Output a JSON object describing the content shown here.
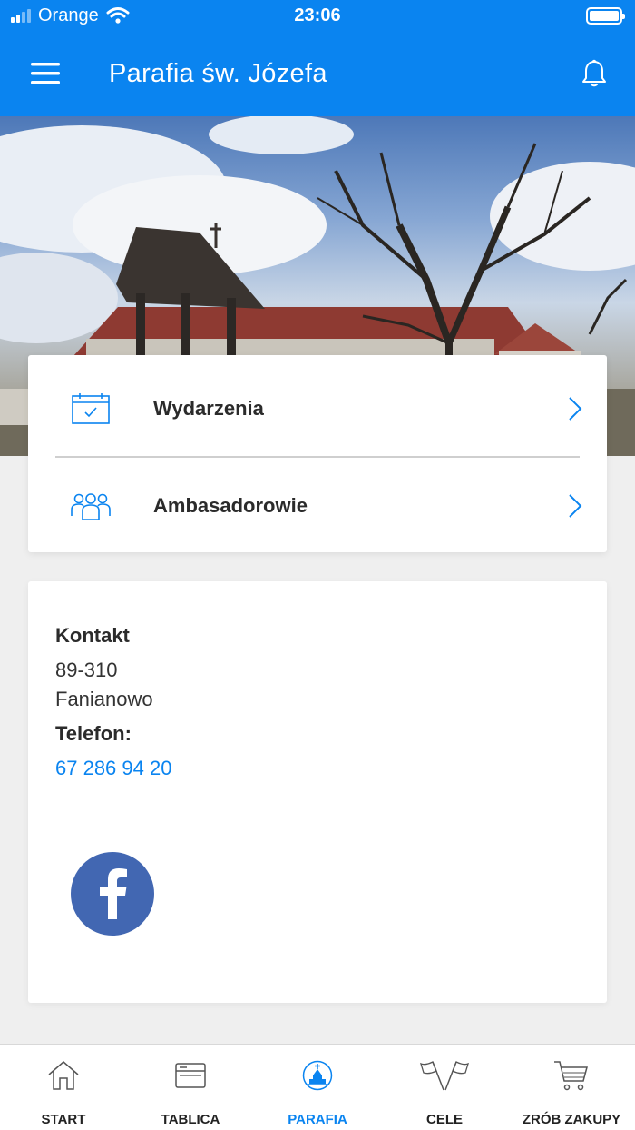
{
  "status_bar": {
    "carrier": "Orange",
    "time": "23:06"
  },
  "header": {
    "title": "Parafia św. Józefa"
  },
  "menu": {
    "items": [
      {
        "label": "Wydarzenia",
        "icon": "calendar-icon"
      },
      {
        "label": "Ambasadorowie",
        "icon": "group-icon"
      }
    ]
  },
  "contact": {
    "heading": "Kontakt",
    "postal_code": "89-310",
    "city": "Fanianowo",
    "phone_label": "Telefon:",
    "phone": "67 286 94 20",
    "social": "facebook-icon"
  },
  "bottom_nav": {
    "items": [
      {
        "label": "START",
        "icon": "home-icon"
      },
      {
        "label": "TABLICA",
        "icon": "board-icon"
      },
      {
        "label": "PARAFIA",
        "icon": "church-icon",
        "active": true
      },
      {
        "label": "CELE",
        "icon": "flags-icon"
      },
      {
        "label": "ZRÓB ZAKUPY",
        "icon": "cart-icon"
      }
    ]
  },
  "colors": {
    "accent": "#0a84f0",
    "facebook": "#4267b2"
  }
}
